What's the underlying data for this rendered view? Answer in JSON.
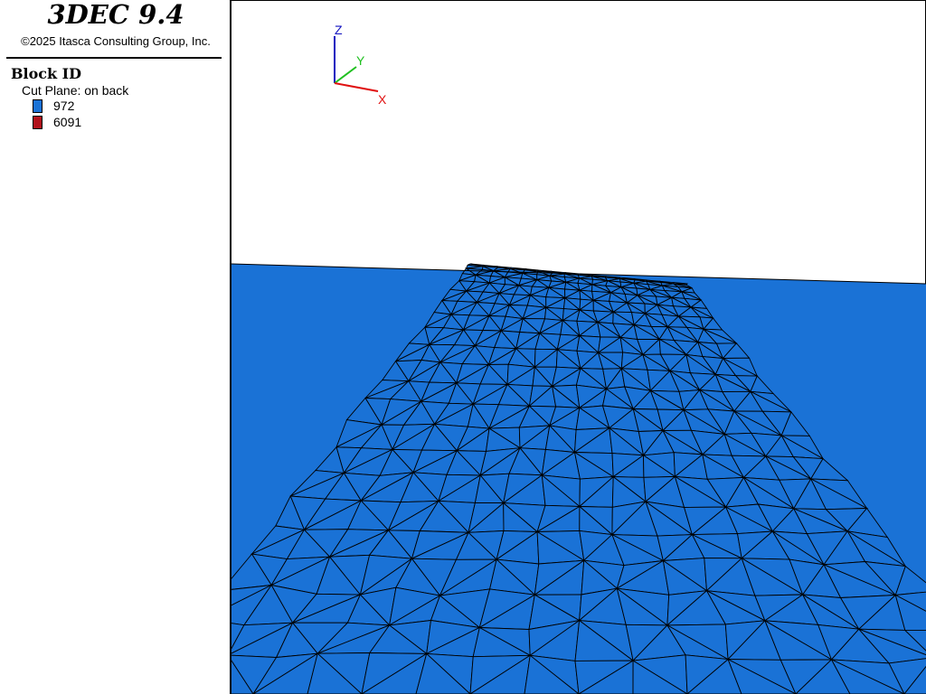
{
  "app": {
    "title": "3DEC 9.4",
    "copyright": "©2025 Itasca Consulting Group, Inc."
  },
  "legend": {
    "heading": "Block  ID",
    "subtitle": "Cut Plane: on back",
    "items": [
      {
        "label": "972",
        "color": "#1a72d6"
      },
      {
        "label": "6091",
        "color": "#b0101a"
      }
    ]
  },
  "axes": {
    "x_label": "X",
    "y_label": "Y",
    "z_label": "Z",
    "x_color": "#e01010",
    "y_color": "#20c020",
    "z_color": "#1010c0"
  },
  "plot": {
    "block_color": "#1a72d6",
    "mesh_line_color": "#000000"
  }
}
